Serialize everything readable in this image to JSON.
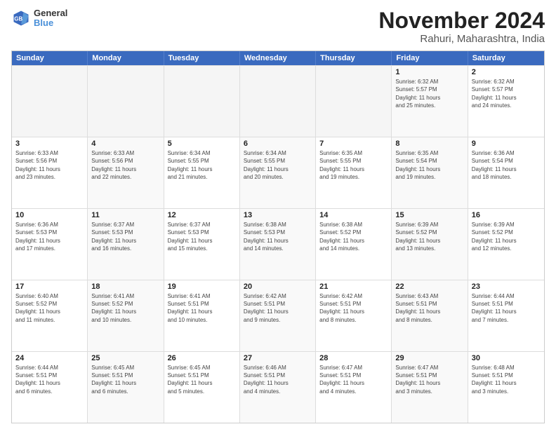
{
  "header": {
    "logo": {
      "line1": "General",
      "line2": "Blue"
    },
    "title": "November 2024",
    "subtitle": "Rahuri, Maharashtra, India"
  },
  "calendar": {
    "days": [
      "Sunday",
      "Monday",
      "Tuesday",
      "Wednesday",
      "Thursday",
      "Friday",
      "Saturday"
    ],
    "rows": [
      [
        {
          "day": "",
          "empty": true
        },
        {
          "day": "",
          "empty": true
        },
        {
          "day": "",
          "empty": true
        },
        {
          "day": "",
          "empty": true
        },
        {
          "day": "",
          "empty": true
        },
        {
          "day": "1",
          "info": "Sunrise: 6:32 AM\nSunset: 5:57 PM\nDaylight: 11 hours\nand 25 minutes."
        },
        {
          "day": "2",
          "info": "Sunrise: 6:32 AM\nSunset: 5:57 PM\nDaylight: 11 hours\nand 24 minutes."
        }
      ],
      [
        {
          "day": "3",
          "info": "Sunrise: 6:33 AM\nSunset: 5:56 PM\nDaylight: 11 hours\nand 23 minutes."
        },
        {
          "day": "4",
          "info": "Sunrise: 6:33 AM\nSunset: 5:56 PM\nDaylight: 11 hours\nand 22 minutes."
        },
        {
          "day": "5",
          "info": "Sunrise: 6:34 AM\nSunset: 5:55 PM\nDaylight: 11 hours\nand 21 minutes."
        },
        {
          "day": "6",
          "info": "Sunrise: 6:34 AM\nSunset: 5:55 PM\nDaylight: 11 hours\nand 20 minutes."
        },
        {
          "day": "7",
          "info": "Sunrise: 6:35 AM\nSunset: 5:55 PM\nDaylight: 11 hours\nand 19 minutes."
        },
        {
          "day": "8",
          "info": "Sunrise: 6:35 AM\nSunset: 5:54 PM\nDaylight: 11 hours\nand 19 minutes."
        },
        {
          "day": "9",
          "info": "Sunrise: 6:36 AM\nSunset: 5:54 PM\nDaylight: 11 hours\nand 18 minutes."
        }
      ],
      [
        {
          "day": "10",
          "info": "Sunrise: 6:36 AM\nSunset: 5:53 PM\nDaylight: 11 hours\nand 17 minutes."
        },
        {
          "day": "11",
          "info": "Sunrise: 6:37 AM\nSunset: 5:53 PM\nDaylight: 11 hours\nand 16 minutes."
        },
        {
          "day": "12",
          "info": "Sunrise: 6:37 AM\nSunset: 5:53 PM\nDaylight: 11 hours\nand 15 minutes."
        },
        {
          "day": "13",
          "info": "Sunrise: 6:38 AM\nSunset: 5:53 PM\nDaylight: 11 hours\nand 14 minutes."
        },
        {
          "day": "14",
          "info": "Sunrise: 6:38 AM\nSunset: 5:52 PM\nDaylight: 11 hours\nand 14 minutes."
        },
        {
          "day": "15",
          "info": "Sunrise: 6:39 AM\nSunset: 5:52 PM\nDaylight: 11 hours\nand 13 minutes."
        },
        {
          "day": "16",
          "info": "Sunrise: 6:39 AM\nSunset: 5:52 PM\nDaylight: 11 hours\nand 12 minutes."
        }
      ],
      [
        {
          "day": "17",
          "info": "Sunrise: 6:40 AM\nSunset: 5:52 PM\nDaylight: 11 hours\nand 11 minutes."
        },
        {
          "day": "18",
          "info": "Sunrise: 6:41 AM\nSunset: 5:52 PM\nDaylight: 11 hours\nand 10 minutes."
        },
        {
          "day": "19",
          "info": "Sunrise: 6:41 AM\nSunset: 5:51 PM\nDaylight: 11 hours\nand 10 minutes."
        },
        {
          "day": "20",
          "info": "Sunrise: 6:42 AM\nSunset: 5:51 PM\nDaylight: 11 hours\nand 9 minutes."
        },
        {
          "day": "21",
          "info": "Sunrise: 6:42 AM\nSunset: 5:51 PM\nDaylight: 11 hours\nand 8 minutes."
        },
        {
          "day": "22",
          "info": "Sunrise: 6:43 AM\nSunset: 5:51 PM\nDaylight: 11 hours\nand 8 minutes."
        },
        {
          "day": "23",
          "info": "Sunrise: 6:44 AM\nSunset: 5:51 PM\nDaylight: 11 hours\nand 7 minutes."
        }
      ],
      [
        {
          "day": "24",
          "info": "Sunrise: 6:44 AM\nSunset: 5:51 PM\nDaylight: 11 hours\nand 6 minutes."
        },
        {
          "day": "25",
          "info": "Sunrise: 6:45 AM\nSunset: 5:51 PM\nDaylight: 11 hours\nand 6 minutes."
        },
        {
          "day": "26",
          "info": "Sunrise: 6:45 AM\nSunset: 5:51 PM\nDaylight: 11 hours\nand 5 minutes."
        },
        {
          "day": "27",
          "info": "Sunrise: 6:46 AM\nSunset: 5:51 PM\nDaylight: 11 hours\nand 4 minutes."
        },
        {
          "day": "28",
          "info": "Sunrise: 6:47 AM\nSunset: 5:51 PM\nDaylight: 11 hours\nand 4 minutes."
        },
        {
          "day": "29",
          "info": "Sunrise: 6:47 AM\nSunset: 5:51 PM\nDaylight: 11 hours\nand 3 minutes."
        },
        {
          "day": "30",
          "info": "Sunrise: 6:48 AM\nSunset: 5:51 PM\nDaylight: 11 hours\nand 3 minutes."
        }
      ]
    ]
  }
}
